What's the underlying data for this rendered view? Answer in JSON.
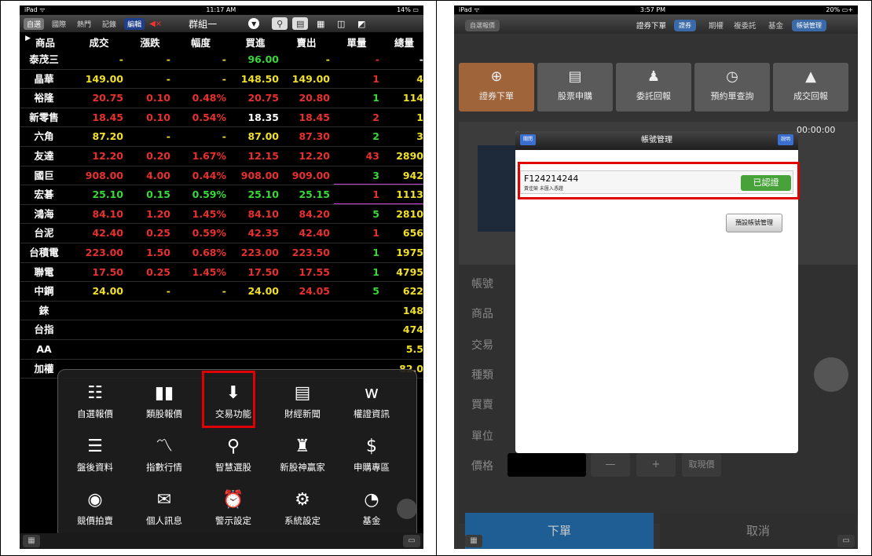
{
  "left": {
    "status": {
      "carrier": "iPad ᯤ",
      "time": "11:17 AM",
      "battery": "14% ▭"
    },
    "toolbar": {
      "tabs": [
        "自選",
        "國際",
        "熱門",
        "記錄"
      ],
      "edit": "編輯",
      "mute": "◀×",
      "group": "群組一"
    },
    "columns": [
      "商品",
      "成交",
      "漲跌",
      "幅度",
      "買進",
      "賣出",
      "單量",
      "總量"
    ],
    "rows": [
      {
        "name": "泰茂三",
        "vals": [
          "-",
          "-",
          "-",
          "96.00",
          "-",
          "-",
          "-"
        ],
        "colors": [
          "y",
          "y",
          "y",
          "g",
          "y",
          "r",
          "w"
        ]
      },
      {
        "name": "晶華",
        "vals": [
          "149.00",
          "-",
          "-",
          "148.50",
          "149.00",
          "1",
          "4"
        ],
        "colors": [
          "y",
          "y",
          "y",
          "y",
          "y",
          "r",
          "y"
        ]
      },
      {
        "name": "裕隆",
        "vals": [
          "20.75",
          "0.10",
          "0.48%",
          "20.75",
          "20.80",
          "1",
          "114"
        ],
        "colors": [
          "r",
          "r",
          "r",
          "r",
          "r",
          "g",
          "y"
        ]
      },
      {
        "name": "新零售",
        "vals": [
          "18.45",
          "0.10",
          "0.54%",
          "18.35",
          "18.45",
          "2",
          "1"
        ],
        "colors": [
          "r",
          "r",
          "r",
          "w",
          "r",
          "r",
          "y"
        ]
      },
      {
        "name": "六角",
        "vals": [
          "87.20",
          "-",
          "-",
          "87.00",
          "87.30",
          "2",
          "3"
        ],
        "colors": [
          "y",
          "y",
          "y",
          "y",
          "r",
          "g",
          "y"
        ]
      },
      {
        "name": "友達",
        "vals": [
          "12.20",
          "0.20",
          "1.67%",
          "12.15",
          "12.20",
          "43",
          "2890"
        ],
        "colors": [
          "r",
          "r",
          "r",
          "r",
          "r",
          "r",
          "y"
        ]
      },
      {
        "name": "國巨",
        "vals": [
          "908.00",
          "4.00",
          "0.44%",
          "908.00",
          "909.00",
          "3",
          "942"
        ],
        "colors": [
          "r",
          "r",
          "r",
          "r",
          "r",
          "g",
          "y"
        ],
        "namecolor": "r"
      },
      {
        "name": "宏碁",
        "vals": [
          "25.10",
          "0.15",
          "0.59%",
          "25.10",
          "25.15",
          "1",
          "1113"
        ],
        "colors": [
          "g",
          "g",
          "g",
          "g",
          "g",
          "r",
          "y"
        ]
      },
      {
        "name": "鴻海",
        "vals": [
          "84.10",
          "1.20",
          "1.45%",
          "84.10",
          "84.20",
          "5",
          "2810"
        ],
        "colors": [
          "r",
          "r",
          "r",
          "r",
          "r",
          "g",
          "y"
        ]
      },
      {
        "name": "台泥",
        "vals": [
          "42.40",
          "0.25",
          "0.59%",
          "42.35",
          "42.40",
          "1",
          "656"
        ],
        "colors": [
          "r",
          "r",
          "r",
          "r",
          "r",
          "r",
          "y"
        ]
      },
      {
        "name": "台積電",
        "vals": [
          "223.00",
          "1.50",
          "0.68%",
          "223.00",
          "223.50",
          "1",
          "1975"
        ],
        "colors": [
          "r",
          "r",
          "r",
          "r",
          "r",
          "g",
          "y"
        ]
      },
      {
        "name": "聯電",
        "vals": [
          "17.50",
          "0.25",
          "1.45%",
          "17.50",
          "17.55",
          "1",
          "4795"
        ],
        "colors": [
          "r",
          "r",
          "r",
          "r",
          "r",
          "g",
          "y"
        ]
      },
      {
        "name": "中鋼",
        "vals": [
          "24.00",
          "-",
          "-",
          "24.00",
          "24.05",
          "5",
          "622"
        ],
        "colors": [
          "y",
          "y",
          "y",
          "y",
          "r",
          "g",
          "y"
        ]
      },
      {
        "name": "錸",
        "vals": [
          "",
          "",
          "",
          "",
          "",
          "",
          "148"
        ],
        "colors": [
          "y",
          "y",
          "y",
          "y",
          "y",
          "y",
          "y"
        ]
      },
      {
        "name": "台指",
        "vals": [
          "",
          "",
          "",
          "",
          "",
          "",
          "474"
        ],
        "colors": [
          "y",
          "y",
          "y",
          "y",
          "y",
          "y",
          "y"
        ]
      },
      {
        "name": "AA",
        "vals": [
          "",
          "",
          "",
          "",
          "",
          "",
          "5.5"
        ],
        "colors": [
          "y",
          "y",
          "y",
          "y",
          "y",
          "y",
          "y"
        ]
      },
      {
        "name": "加權",
        "vals": [
          "",
          "",
          "",
          "",
          "",
          "",
          "82.0"
        ],
        "colors": [
          "y",
          "y",
          "y",
          "y",
          "y",
          "y",
          "y"
        ]
      }
    ],
    "menu": [
      {
        "label": "自選報價",
        "icon": "☷"
      },
      {
        "label": "類股報價",
        "icon": "▮▮"
      },
      {
        "label": "交易功能",
        "icon": "⬇"
      },
      {
        "label": "財經新聞",
        "icon": "▤"
      },
      {
        "label": "權證資訊",
        "icon": "w"
      },
      {
        "label": "盤後資料",
        "icon": "☰"
      },
      {
        "label": "指數行情",
        "icon": "〽"
      },
      {
        "label": "智慧選股",
        "icon": "⚲"
      },
      {
        "label": "新股神贏家",
        "icon": "♜"
      },
      {
        "label": "申購專區",
        "icon": "$"
      },
      {
        "label": "競價拍賣",
        "icon": "◉"
      },
      {
        "label": "個人訊息",
        "icon": "✉"
      },
      {
        "label": "警示設定",
        "icon": "⏰"
      },
      {
        "label": "系統設定",
        "icon": "⚙"
      },
      {
        "label": "基金",
        "icon": "◔"
      }
    ]
  },
  "right": {
    "status": {
      "carrier": "iPad ᯤ",
      "time": "3:57 PM",
      "battery": "20% ▭+"
    },
    "topbar": {
      "left": "自選報價",
      "order": "證券下單",
      "active": "證券",
      "options": "期權",
      "multi": "複委託",
      "fund": "基金",
      "acct": "帳號管理"
    },
    "tiles": [
      {
        "label": "證券下單",
        "icon": "⊕"
      },
      {
        "label": "股票申購",
        "icon": "▤"
      },
      {
        "label": "委託回報",
        "icon": "♟"
      },
      {
        "label": "預約單查詢",
        "icon": "◷"
      },
      {
        "label": "成交回報",
        "icon": "▲"
      }
    ],
    "time": "00:00:00",
    "form": {
      "labels": [
        "帳號",
        "商品",
        "交易",
        "種類",
        "買賣",
        "單位",
        "價格"
      ],
      "minus": "—",
      "plus": "+",
      "current": "取現價"
    },
    "bottom": {
      "order": "下單",
      "cancel": "取消"
    },
    "modal": {
      "title": "帳號管理",
      "left_btn": "關閉",
      "right_btn": "說明",
      "account_id": "F124214244",
      "account_sub": "黃佳榮 未匯入憑證",
      "verified": "已認證",
      "default_btn": "預設帳號管理"
    }
  }
}
